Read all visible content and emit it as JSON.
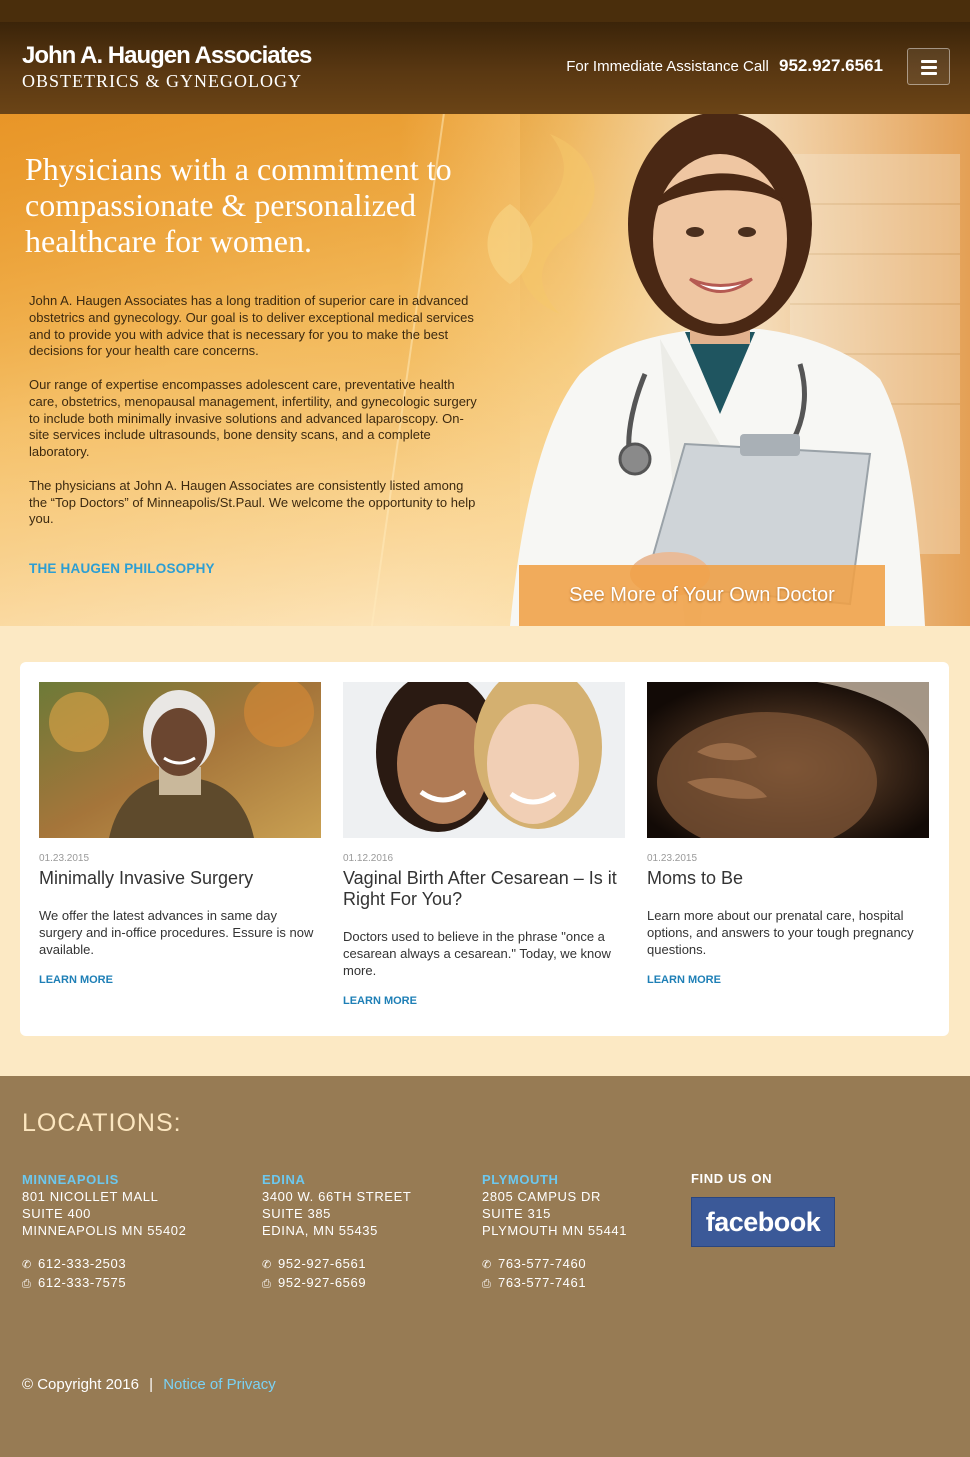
{
  "header": {
    "logo_line1": "John A. Haugen Associates",
    "logo_line2": "OBSTETRICS & GYNEGOLOGY",
    "assist_label": "For Immediate Assistance Call",
    "assist_phone": "952.927.6561",
    "menu_icon": "hamburger-icon"
  },
  "hero": {
    "title": "Physicians with a commitment to compassionate & personalized healthcare for women.",
    "paragraphs": [
      "John A. Haugen Associates has a long tradition of superior care in advanced obstetrics and gynecology. Our goal is to deliver exceptional medical services and to provide you with advice that is necessary for you to make the best decisions for your health care concerns.",
      "Our range of expertise encompasses adolescent care, preventative health care, obstetrics, menopausal management, infertility, and gynecologic surgery to include both minimally invasive solutions and advanced laparoscopy. On-site services include ultrasounds, bone density scans, and a complete laboratory.",
      "The physicians at John A. Haugen Associates are consistently listed among the “Top Doctors” of Minneapolis/St.Paul. We welcome the opportunity to help you."
    ],
    "philosophy_link": "THE HAUGEN PHILOSOPHY",
    "doctor_cta": "See More of Your Own Doctor"
  },
  "cards": [
    {
      "date": "01.23.2015",
      "title": "Minimally Invasive Surgery",
      "desc": "We offer the latest advances in same day surgery and in-office procedures. Essure is now available.",
      "link": "LEARN MORE"
    },
    {
      "date": "01.12.2016",
      "title": "Vaginal Birth After Cesarean – Is it Right For You?",
      "desc": "Doctors used to believe in the phrase \"once a cesarean always a cesarean.\" Today, we know more.",
      "link": "LEARN MORE"
    },
    {
      "date": "01.23.2015",
      "title": "Moms to Be",
      "desc": "Learn more about our prenatal care, hospital options, and answers to your tough pregnancy questions.",
      "link": "LEARN MORE"
    }
  ],
  "footer": {
    "locations_title": "LOCATIONS:",
    "locations": [
      {
        "name": "MINNEAPOLIS",
        "line1": "801 NICOLLET MALL",
        "line2": "SUITE 400",
        "line3": "MINNEAPOLIS MN 55402",
        "phone": "612-333-2503",
        "fax": "612-333-7575"
      },
      {
        "name": "EDINA",
        "line1": "3400 W. 66TH STREET",
        "line2": "SUITE 385",
        "line3": "EDINA, MN 55435",
        "phone": "952-927-6561",
        "fax": "952-927-6569"
      },
      {
        "name": "PLYMOUTH",
        "line1": "2805 CAMPUS DR",
        "line2": "SUITE 315",
        "line3": "PLYMOUTH MN 55441",
        "phone": "763-577-7460",
        "fax": "763-577-7461"
      }
    ],
    "find_us": "FIND US ON",
    "facebook": "facebook",
    "copyright": "© Copyright 2016",
    "separator": "|",
    "privacy_link": "Notice of Privacy"
  },
  "colors": {
    "header": "#4a2e0c",
    "accent_blue": "#2c9ed3",
    "footer": "#977b54",
    "location_name": "#6cc8ef",
    "facebook": "#3b5998"
  }
}
